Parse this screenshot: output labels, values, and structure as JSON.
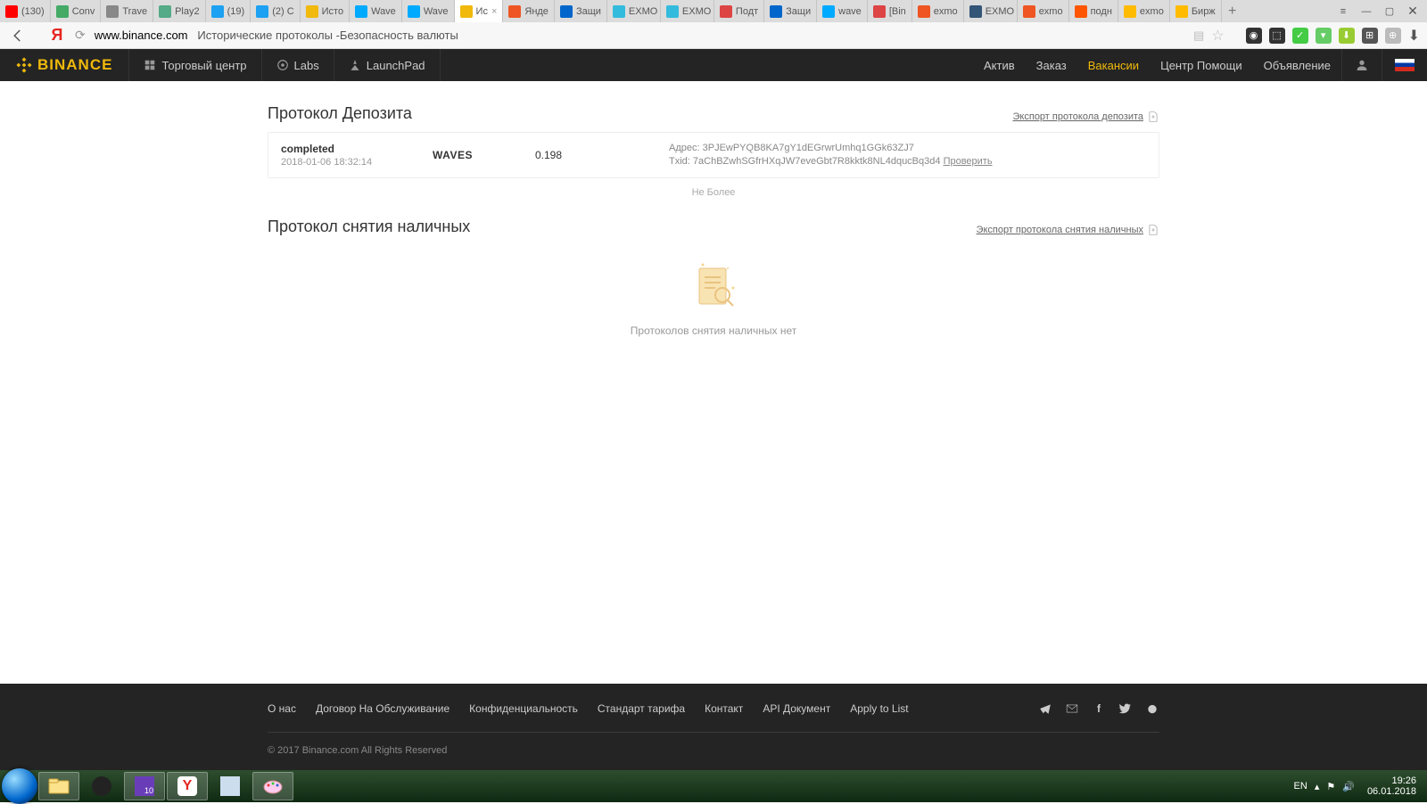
{
  "browser": {
    "tabs": [
      {
        "label": "(130)",
        "color": "#ff0000"
      },
      {
        "label": "Conv",
        "color": "#4a6"
      },
      {
        "label": "Trave",
        "color": "#888"
      },
      {
        "label": "Play2",
        "color": "#5a8"
      },
      {
        "label": "(19)",
        "color": "#1da1f2"
      },
      {
        "label": "(2) C",
        "color": "#1da1f2"
      },
      {
        "label": "Исто",
        "color": "#f0b90b"
      },
      {
        "label": "Wave",
        "color": "#0af"
      },
      {
        "label": "Wave",
        "color": "#0af"
      },
      {
        "label": "Ис",
        "color": "#f0b90b",
        "active": true,
        "close": true
      },
      {
        "label": "Янде",
        "color": "#e52"
      },
      {
        "label": "Защи",
        "color": "#06c"
      },
      {
        "label": "EXMO",
        "color": "#3bd"
      },
      {
        "label": "EXMO",
        "color": "#3bd"
      },
      {
        "label": "Подт",
        "color": "#d44"
      },
      {
        "label": "Защи",
        "color": "#06c"
      },
      {
        "label": "wave",
        "color": "#0af"
      },
      {
        "label": "[Bin",
        "color": "#d44"
      },
      {
        "label": "exmo",
        "color": "#e52"
      },
      {
        "label": "EXMO",
        "color": "#357"
      },
      {
        "label": "exmo",
        "color": "#e52"
      },
      {
        "label": "подн",
        "color": "#f50"
      },
      {
        "label": "exmo",
        "color": "#fb0"
      },
      {
        "label": "Бирж",
        "color": "#fb0"
      }
    ],
    "url_host": "www.binance.com",
    "url_title": "Исторические протоколы -Безопасность валюты"
  },
  "header": {
    "brand": "BINANCE",
    "left": [
      {
        "label": "Торговый центр"
      },
      {
        "label": "Labs"
      },
      {
        "label": "LaunchPad"
      }
    ],
    "right": [
      {
        "label": "Актив"
      },
      {
        "label": "Заказ"
      },
      {
        "label": "Вакансии",
        "active": true
      },
      {
        "label": "Центр Помощи"
      },
      {
        "label": "Объявление"
      }
    ]
  },
  "deposit": {
    "title": "Протокол Депозита",
    "export": "Экспорт протокола депозита",
    "row": {
      "status": "completed",
      "datetime": "2018-01-06 18:32:14",
      "coin": "WAVES",
      "amount": "0.198",
      "addr_label": "Адрес:",
      "addr": "3PJEwPYQB8KA7gY1dEGrwrUmhq1GGk63ZJ7",
      "txid_label": "Txid:",
      "txid": "7aChBZwhSGfrHXqJW7eveGbt7R8kktk8NL4dqucBq3d4",
      "check": "Проверить"
    },
    "nomore": "Не Более"
  },
  "withdraw": {
    "title": "Протокол снятия наличных",
    "export": "Экспорт протокола снятия наличных",
    "empty": "Протоколов снятия наличных нет"
  },
  "footer": {
    "links": [
      "О нас",
      "Договор На Обслуживание",
      "Конфиденциальность",
      "Стандарт тарифа",
      "Контакт",
      "API Документ",
      "Apply to List"
    ],
    "copyright": "© 2017 Binance.com All Rights Reserved"
  },
  "taskbar": {
    "lang": "EN",
    "time": "19:26",
    "date": "06.01.2018"
  }
}
